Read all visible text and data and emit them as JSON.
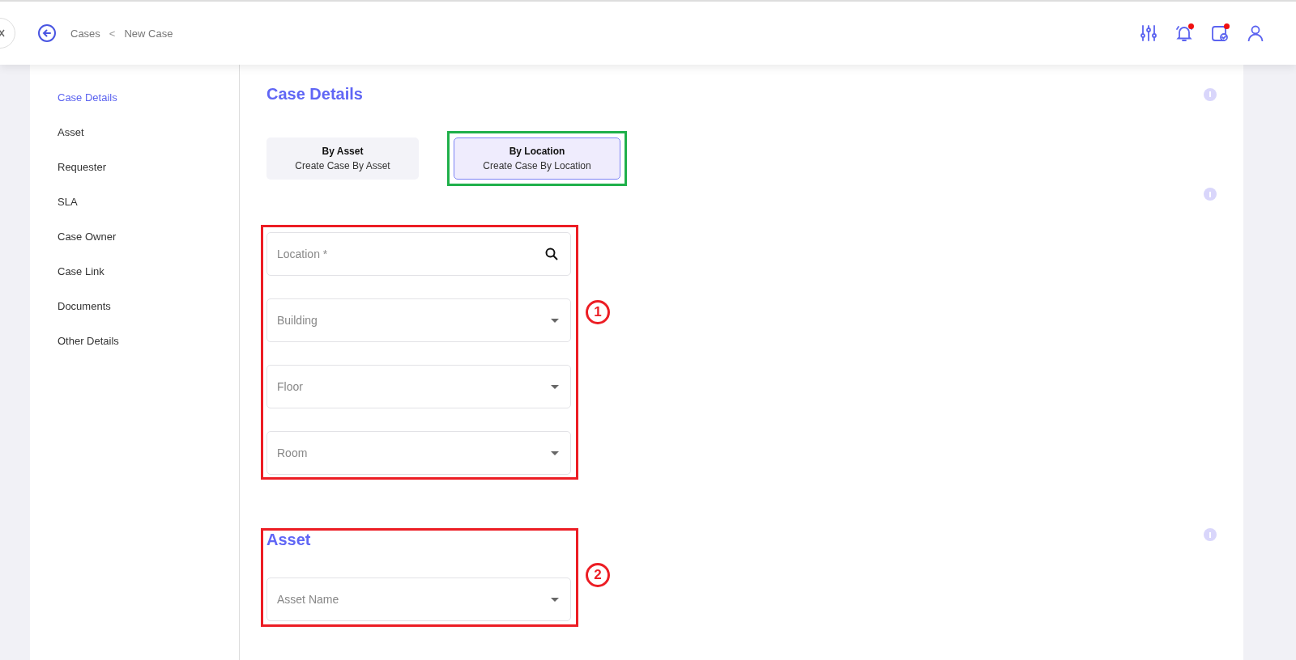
{
  "topbar": {
    "breadcrumb": [
      "Cases",
      "New Case"
    ],
    "separator": "<",
    "icons": [
      {
        "kind": "sliders",
        "badge": false
      },
      {
        "kind": "bell",
        "badge": true
      },
      {
        "kind": "calendar",
        "badge": true
      },
      {
        "kind": "user",
        "badge": false
      }
    ]
  },
  "sidebar": {
    "items": [
      {
        "label": "Case Details",
        "selected": true
      },
      {
        "label": "Asset",
        "selected": false
      },
      {
        "label": "Requester",
        "selected": false
      },
      {
        "label": "SLA",
        "selected": false
      },
      {
        "label": "Case Owner",
        "selected": false
      },
      {
        "label": "Case Link",
        "selected": false
      },
      {
        "label": "Documents",
        "selected": false
      },
      {
        "label": "Other Details",
        "selected": false
      }
    ]
  },
  "case_details": {
    "title": "Case Details",
    "mode_tabs": [
      {
        "title": "By Asset",
        "subtitle": "Create Case By Asset",
        "selected": false,
        "highlighted": false
      },
      {
        "title": "By Location",
        "subtitle": "Create Case By Location",
        "selected": true,
        "highlighted": true
      }
    ],
    "location_group": {
      "marker": "1",
      "fields": [
        {
          "kind": "search",
          "placeholder": "Location *"
        },
        {
          "kind": "select",
          "placeholder": "Building"
        },
        {
          "kind": "select",
          "placeholder": "Floor"
        },
        {
          "kind": "select",
          "placeholder": "Room"
        }
      ]
    }
  },
  "asset": {
    "title": "Asset",
    "marker": "2",
    "fields": [
      {
        "kind": "select",
        "placeholder": "Asset Name"
      }
    ]
  }
}
